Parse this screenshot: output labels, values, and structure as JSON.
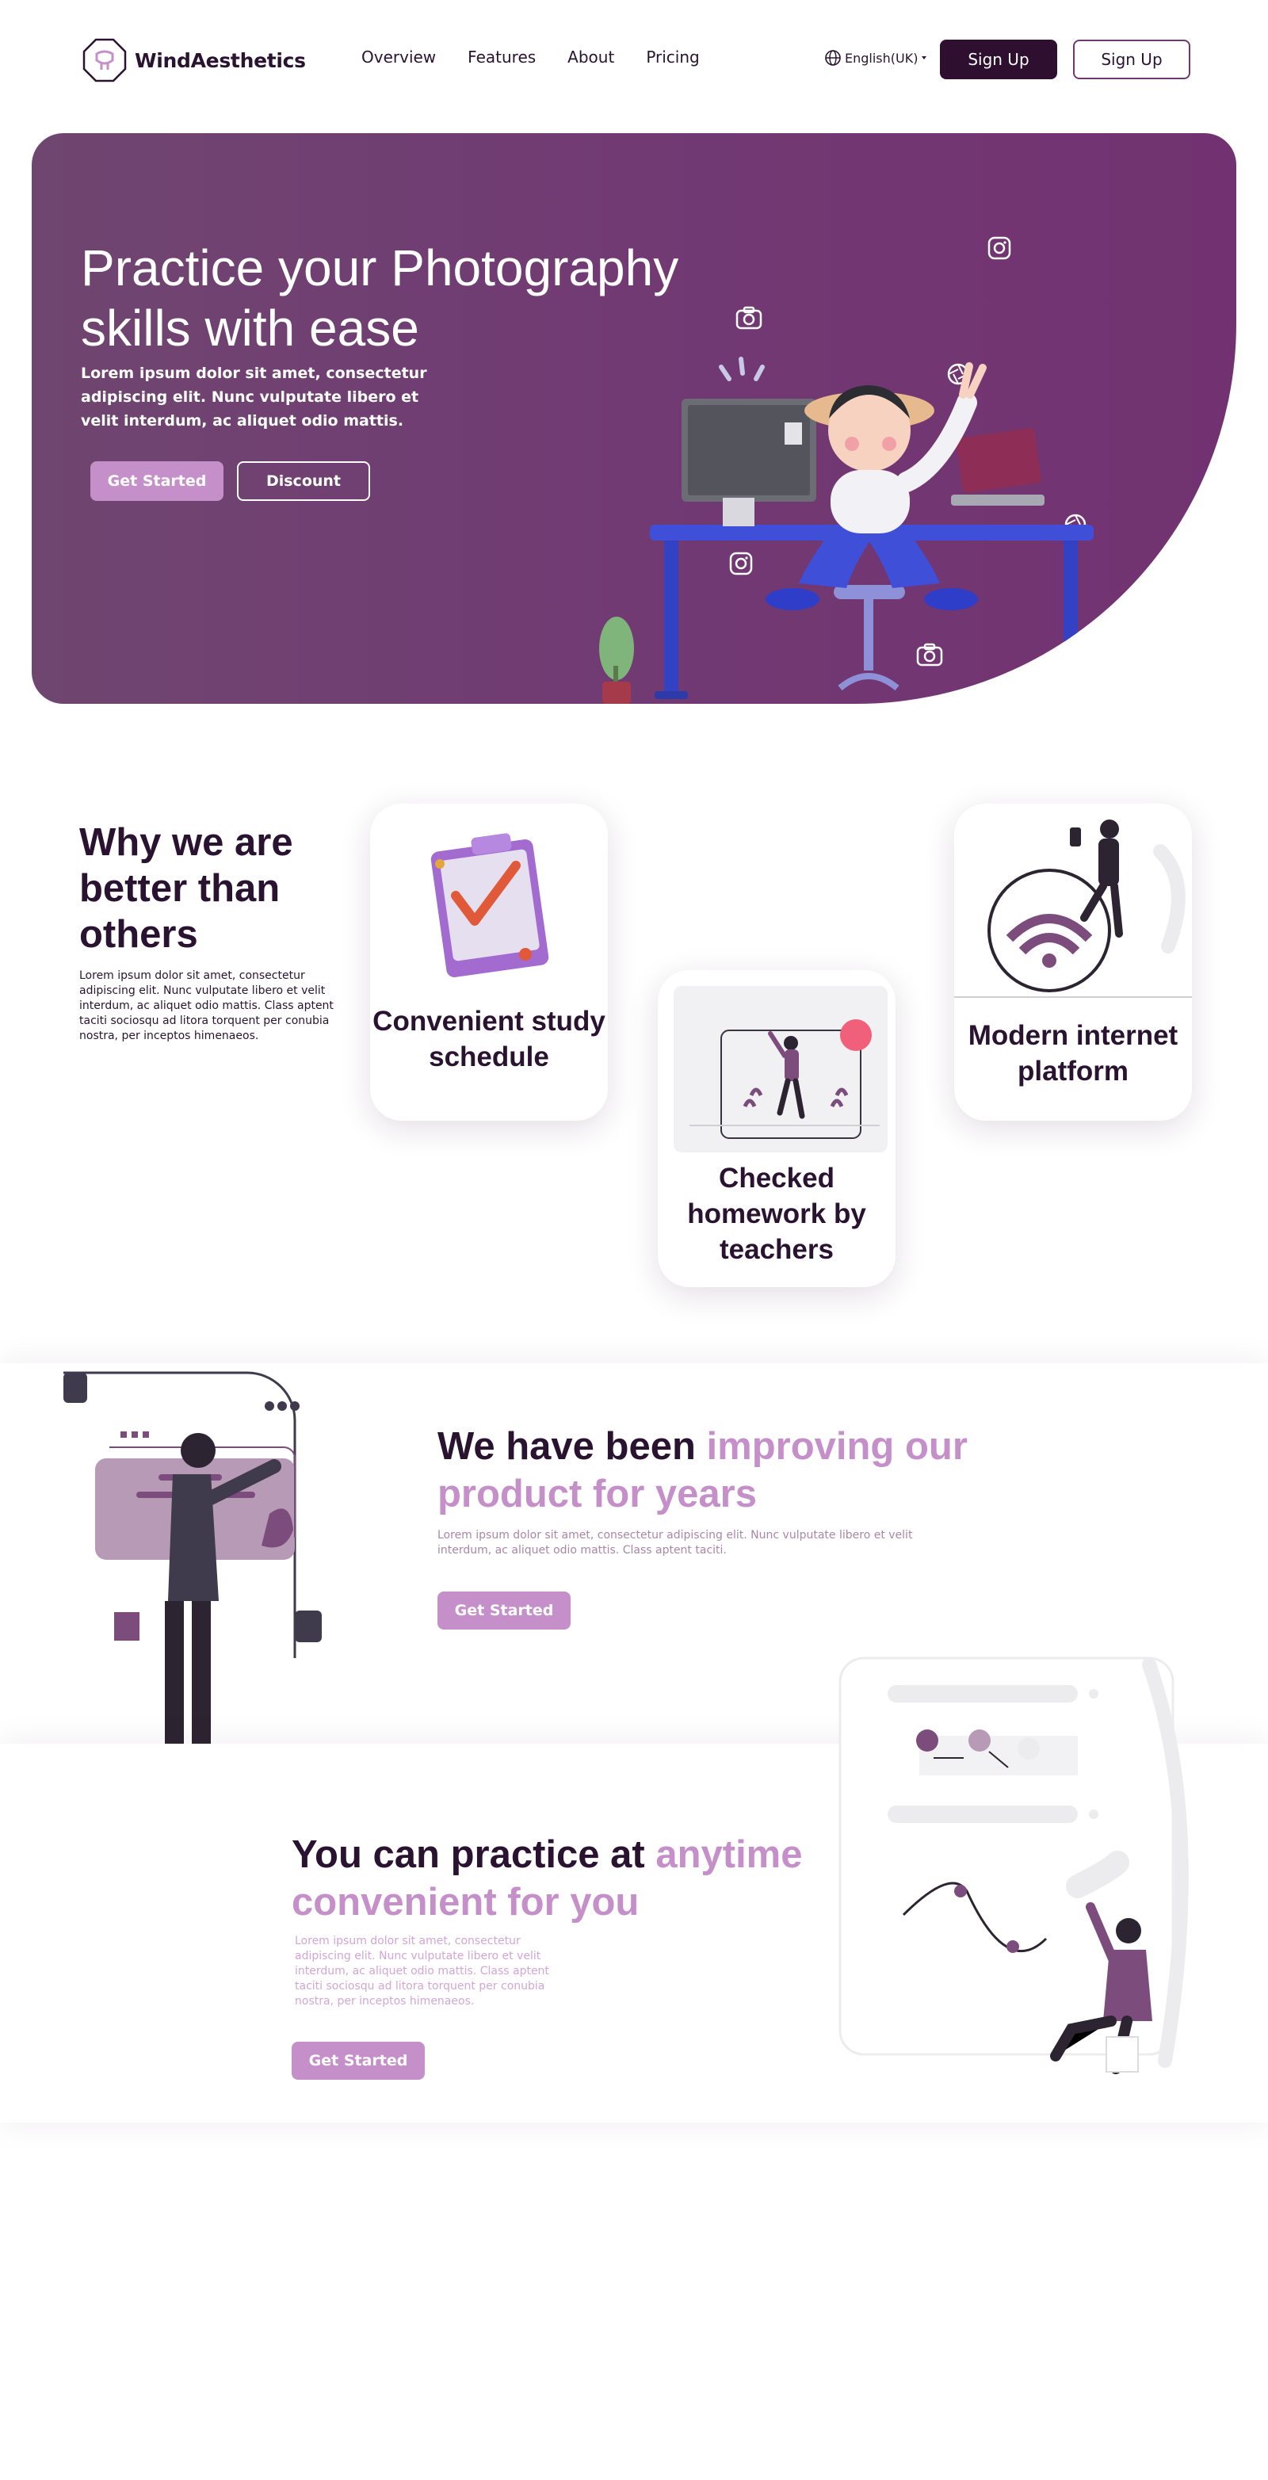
{
  "nav": {
    "logo_text": "WindAesthetics",
    "links": [
      "Overview",
      "Features",
      "About",
      "Pricing"
    ],
    "language": "English(UK)",
    "signup_filled": "Sign Up",
    "signup_outline": "Sign Up"
  },
  "hero": {
    "title": "Practice your Photography skills with ease",
    "subtitle": "Lorem ipsum dolor sit amet, consectetur adipiscing elit. Nunc vulputate libero et velit interdum, ac aliquet odio mattis.",
    "cta_primary": "Get Started",
    "cta_secondary": "Discount"
  },
  "why": {
    "title": "Why we are better than others",
    "text": "Lorem ipsum dolor sit amet, consectetur adipiscing elit. Nunc vulputate libero et velit interdum, ac aliquet odio mattis. Class aptent taciti sociosqu ad litora torquent per conubia nostra, per inceptos himenaeos.",
    "cards": [
      {
        "label": "Convenient study schedule"
      },
      {
        "label": "Checked homework by teachers"
      },
      {
        "label": "Modern internet platform"
      }
    ]
  },
  "section_improving": {
    "title_plain": "We have been ",
    "title_accent": "improving our product for years",
    "text": "Lorem ipsum dolor sit amet, consectetur adipiscing elit. Nunc vulputate libero et velit interdum, ac aliquet odio mattis. Class aptent taciti.",
    "cta": "Get Started"
  },
  "section_anytime": {
    "title_plain": "You can practice at ",
    "title_accent": "anytime convenient for you",
    "text": "Lorem ipsum dolor sit amet, consectetur adipiscing elit. Nunc vulputate libero et velit interdum, ac aliquet odio mattis. Class aptent taciti sociosqu ad litora torquent per conubia nostra, per inceptos himenaeos.",
    "cta": "Get Started"
  },
  "colors": {
    "brand_dark": "#2f0f2f",
    "brand_accent": "#c58fc9",
    "hero_bg": "#713a73"
  },
  "icons": [
    "logo-icon",
    "globe-icon",
    "chevron-down-icon",
    "camera-icon",
    "instagram-icon",
    "aperture-icon"
  ]
}
